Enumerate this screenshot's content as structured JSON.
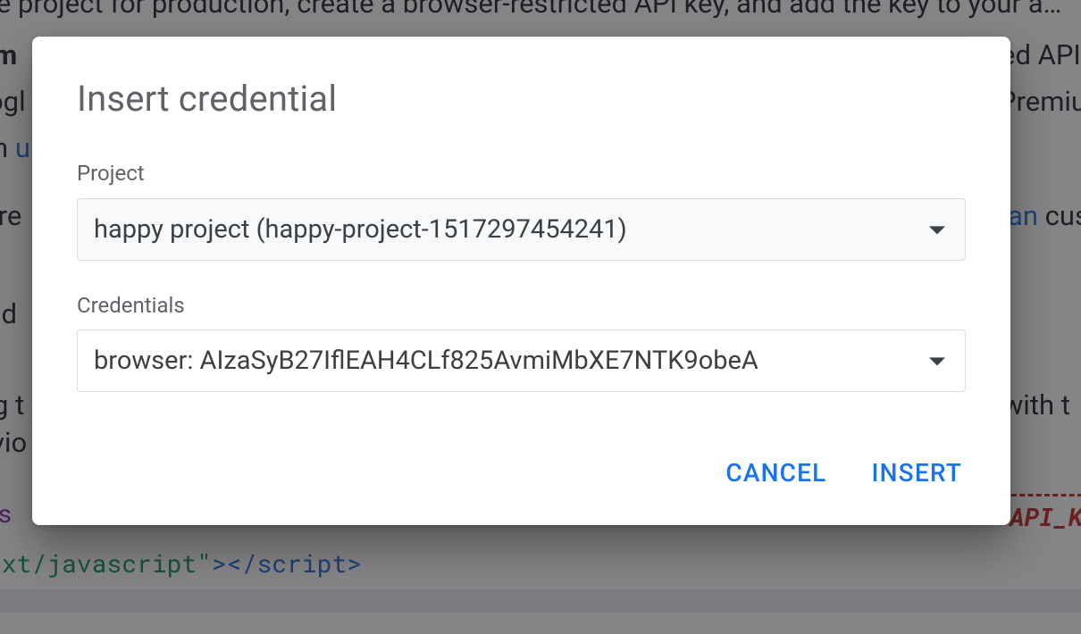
{
  "backdrop": {
    "line_top": "…te project for production, create a browser-restricted API key, and add the key to your a…",
    "line_um": "um",
    "line_ed_api": "ed API",
    "line_og": "ogl",
    "line_premiu": "Premiu",
    "line_n": "n ",
    "link_u": "u…",
    "line_re": "ore ",
    "link_an": "an",
    "line_cus": " cus",
    "line_ld": "ld",
    "line_g_t": "g t",
    "line_with_t": " with t",
    "line_vio": "vio",
    "code_as": " as",
    "code_kapi": "API_K",
    "code_ext": "ext/javascript\"",
    "code_close_script": "></script",
    "code_close_script_end": ">"
  },
  "dialog": {
    "title": "Insert credential",
    "project_label": "Project",
    "project_value": "happy project (happy-project-1517297454241)",
    "credentials_label": "Credentials",
    "credentials_value": "browser: AIzaSyB27IflEAH4CLf825AvmiMbXE7NTK9obeA",
    "cancel": "CANCEL",
    "insert": "INSERT"
  }
}
